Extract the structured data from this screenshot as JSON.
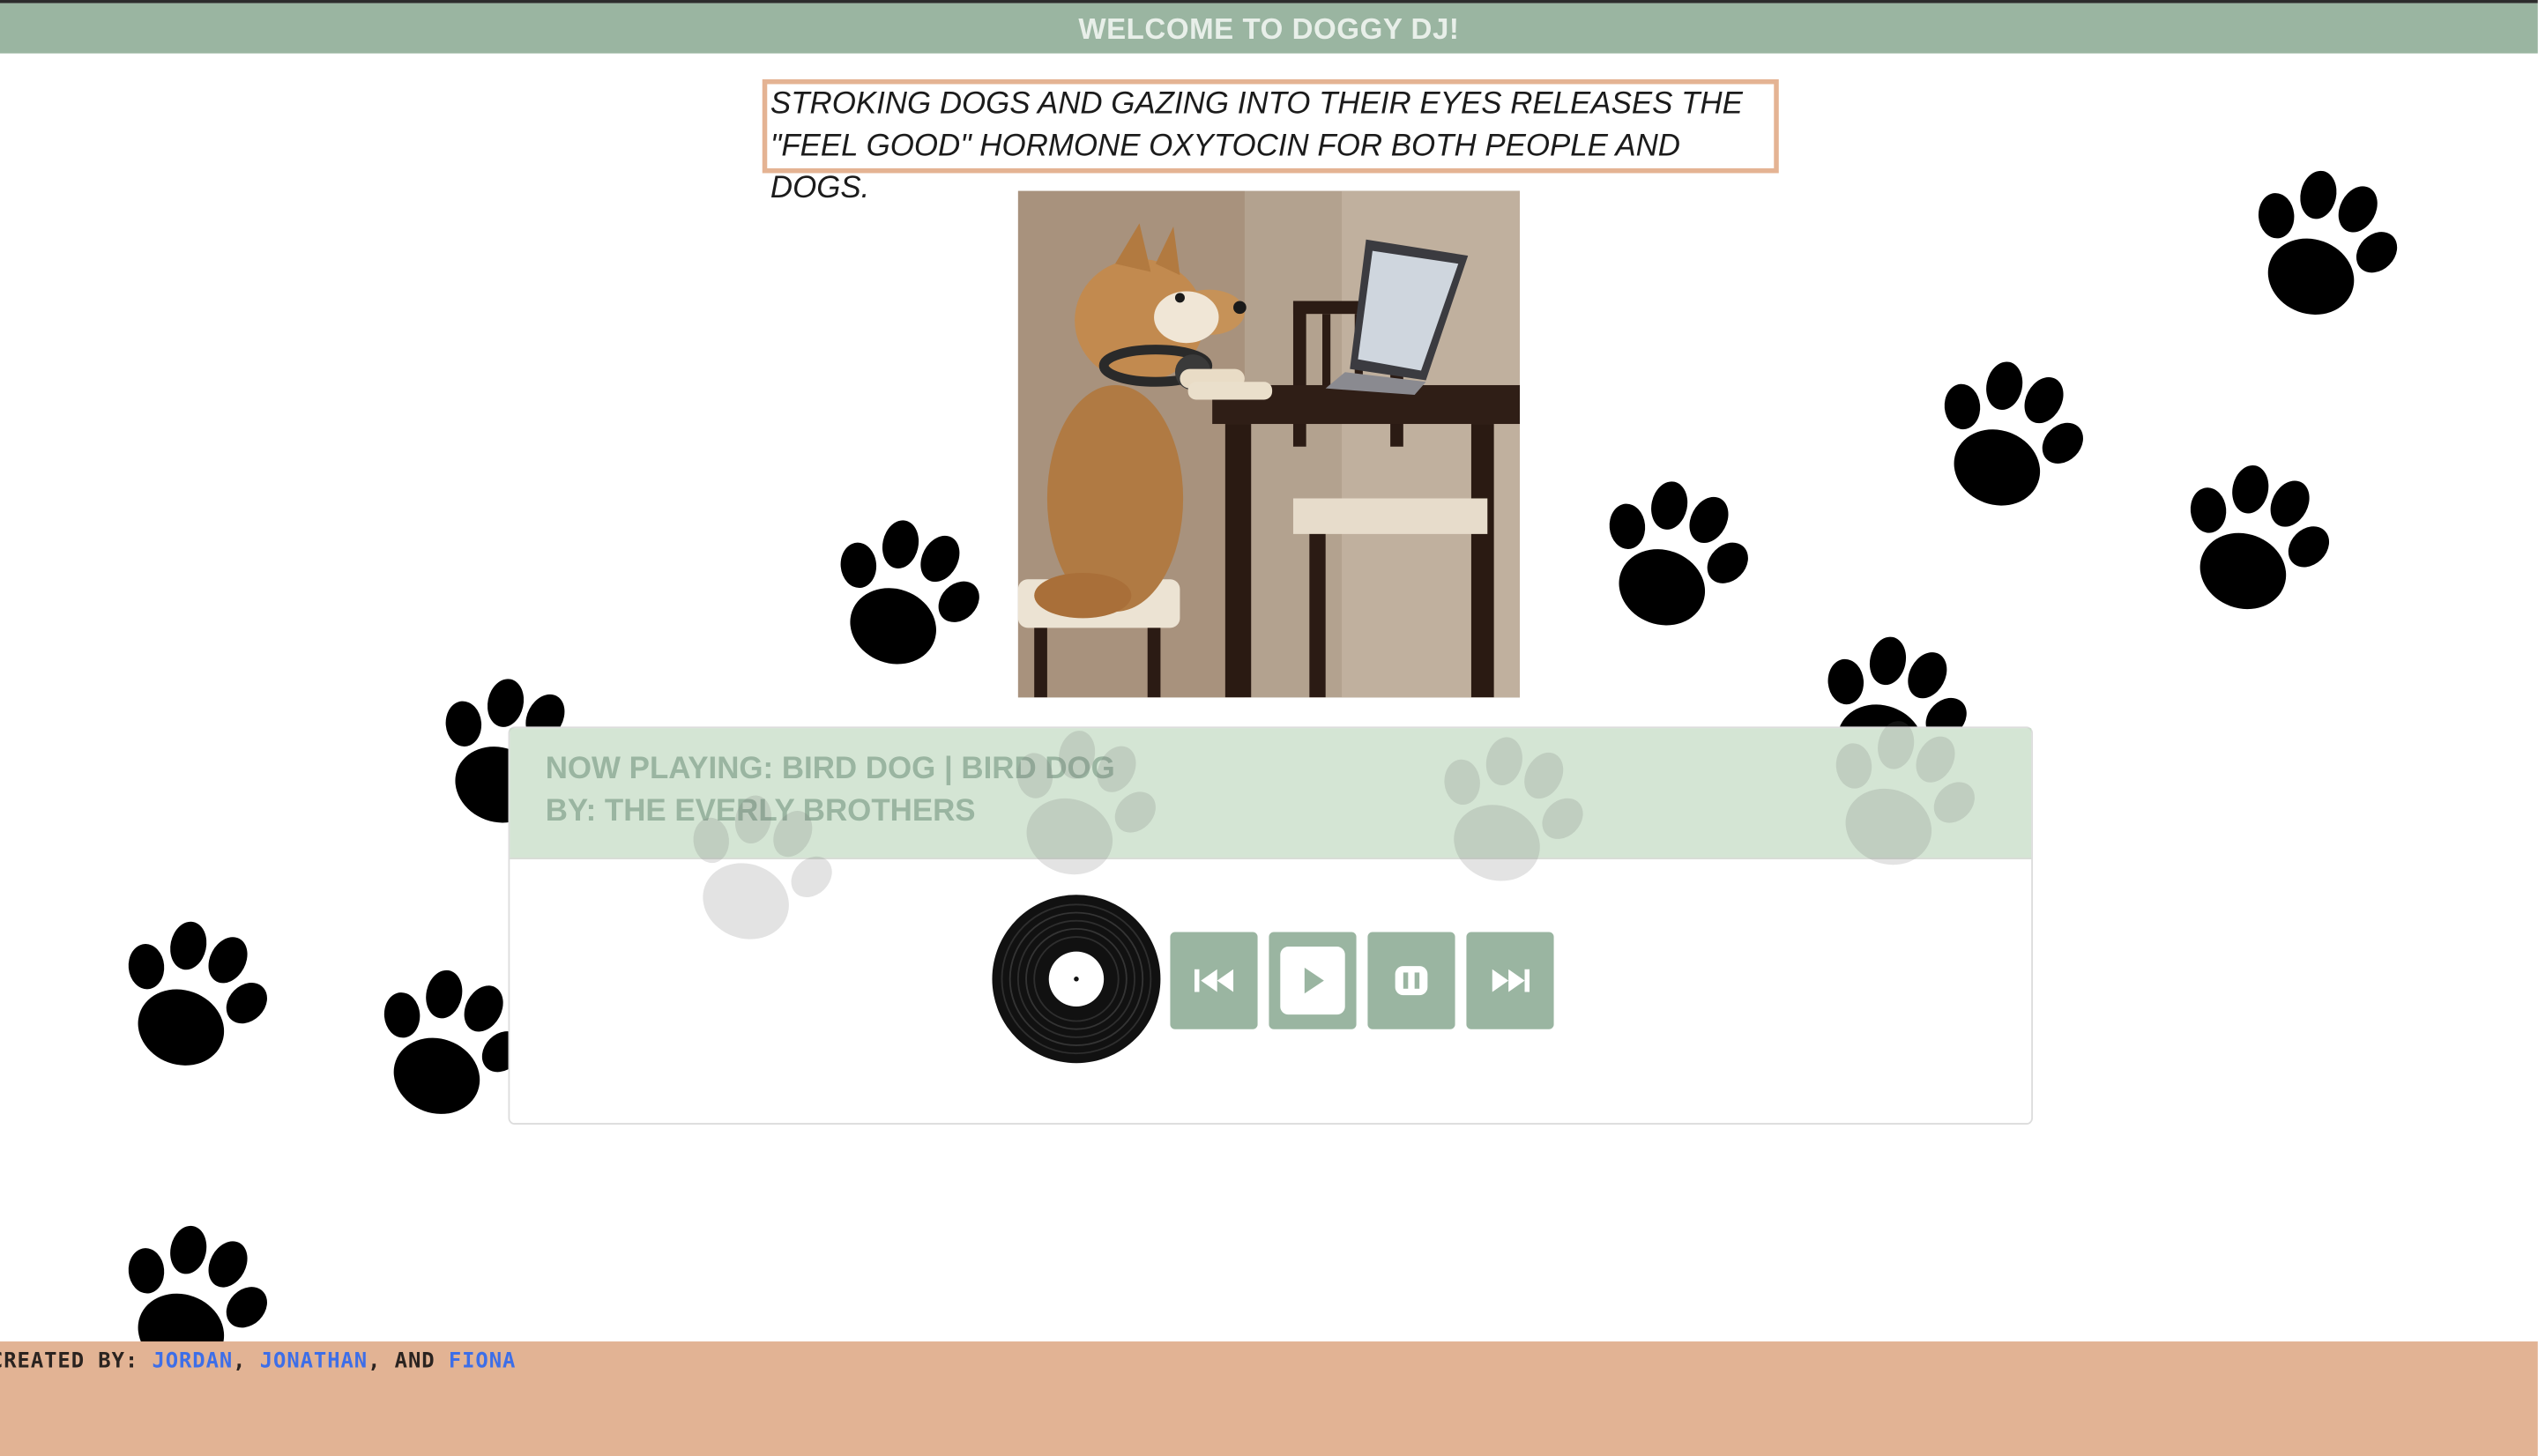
{
  "header": {
    "title": "WELCOME TO DOGGY DJ!"
  },
  "fact": {
    "text": "STROKING DOGS AND GAZING INTO THEIR EYES RELEASES THE \"FEEL GOOD\" HORMONE OXYTOCIN FOR BOTH PEOPLE AND DOGS."
  },
  "player": {
    "now_playing": "NOW PLAYING: BIRD DOG | BIRD DOG",
    "artist": "BY: THE EVERLY BROTHERS",
    "controls": [
      {
        "name": "previous",
        "icon": "skip-back-icon"
      },
      {
        "name": "play",
        "icon": "play-icon"
      },
      {
        "name": "pause",
        "icon": "pause-icon"
      },
      {
        "name": "next",
        "icon": "fast-forward-icon"
      }
    ]
  },
  "footer": {
    "prefix": "CREATED BY: ",
    "names": [
      "JORDAN",
      "JONATHAN",
      "FIONA"
    ],
    "sep1": ", ",
    "sep2": ", AND "
  },
  "colors": {
    "header_bg": "#9ab5a1",
    "accent_sage": "#9ab5a1",
    "player_head_bg": "#c4dbc3",
    "fact_border": "#e4b393",
    "footer_bg": "#e2b394",
    "link_blue": "#3d6ee8"
  }
}
